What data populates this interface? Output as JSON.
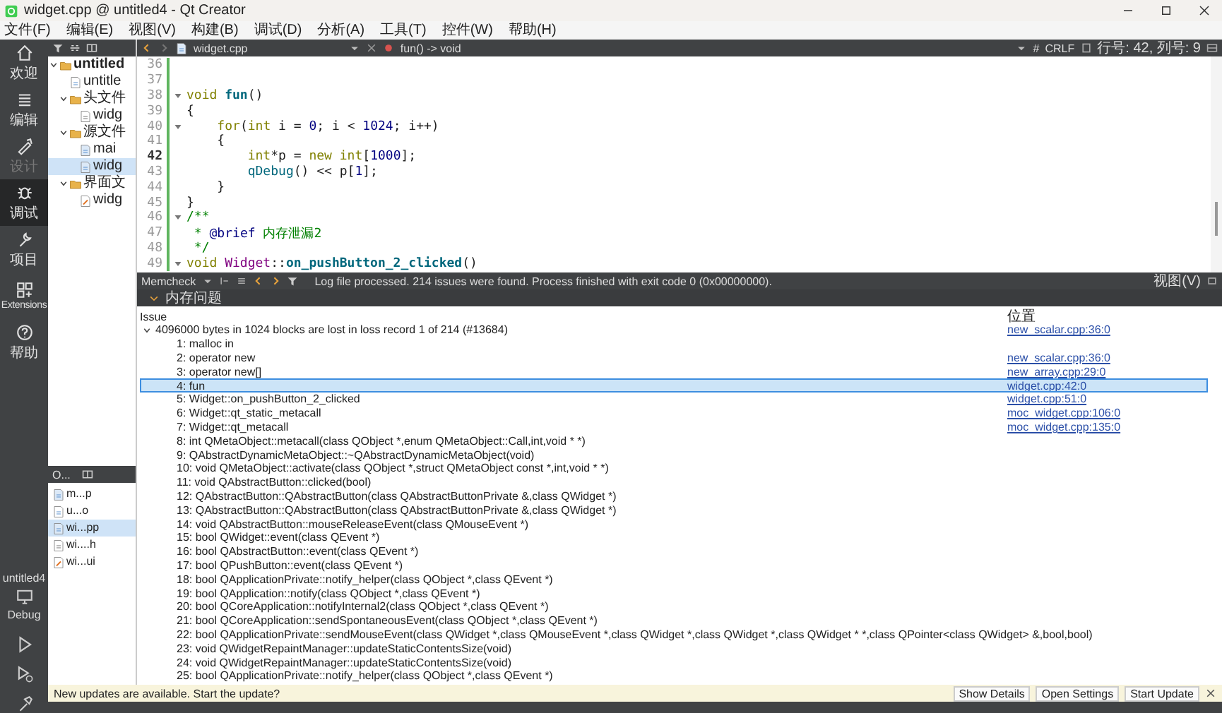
{
  "window": {
    "title": "widget.cpp @ untitled4 - Qt Creator"
  },
  "menu": [
    "文件(F)",
    "编辑(E)",
    "视图(V)",
    "构建(B)",
    "调试(D)",
    "分析(A)",
    "工具(T)",
    "控件(W)",
    "帮助(H)"
  ],
  "mode_bar": {
    "items": [
      {
        "label": "欢迎",
        "selected": false,
        "disabled": false
      },
      {
        "label": "编辑",
        "selected": false,
        "disabled": false
      },
      {
        "label": "设计",
        "selected": false,
        "disabled": true
      },
      {
        "label": "调试",
        "selected": true,
        "disabled": false
      },
      {
        "label": "项目",
        "selected": false,
        "disabled": false
      },
      {
        "label": "Extensions",
        "selected": false,
        "disabled": false
      },
      {
        "label": "帮助",
        "selected": false,
        "disabled": false
      }
    ],
    "target": {
      "project": "untitled4",
      "config": "Debug"
    }
  },
  "project_tree": [
    {
      "label": "untitled",
      "kind": "project",
      "selected": false,
      "expanded": true,
      "children": [
        {
          "label": "untitle",
          "kind": "pro",
          "selected": false
        },
        {
          "label": "头文件",
          "kind": "folder",
          "selected": false,
          "expanded": true,
          "children": [
            {
              "label": "widg",
              "kind": "header",
              "selected": false
            }
          ]
        },
        {
          "label": "源文件",
          "kind": "folder",
          "selected": false,
          "expanded": true,
          "children": [
            {
              "label": "mai",
              "kind": "source",
              "selected": false
            },
            {
              "label": "widg",
              "kind": "source",
              "selected": true
            }
          ]
        },
        {
          "label": "界面文",
          "kind": "folder",
          "selected": false,
          "expanded": true,
          "children": [
            {
              "label": "widg",
              "kind": "form",
              "selected": false
            }
          ]
        }
      ]
    }
  ],
  "open_documents": {
    "title": "O...",
    "items": [
      {
        "label": "m...p",
        "kind": "source",
        "selected": false
      },
      {
        "label": "u...o",
        "kind": "pro",
        "selected": false
      },
      {
        "label": "wi...pp",
        "kind": "source",
        "selected": true
      },
      {
        "label": "wi....h",
        "kind": "header",
        "selected": false
      },
      {
        "label": "wi...ui",
        "kind": "form",
        "selected": false
      }
    ]
  },
  "editor": {
    "file_tab": "widget.cpp",
    "symbol": "fun() -> void",
    "encoding_mark": "#",
    "line_ending": "CRLF",
    "position": "行号: 42, 列号: 9",
    "lines": [
      {
        "number": "36",
        "current": false,
        "foldable": false
      },
      {
        "number": "37",
        "current": false,
        "foldable": false
      },
      {
        "number": "38",
        "current": false,
        "foldable": true,
        "tokens": [
          {
            "text": "void ",
            "kind": "keyword"
          },
          {
            "text": "fun",
            "kind": "function"
          },
          {
            "text": "()",
            "kind": "plain"
          }
        ]
      },
      {
        "number": "39",
        "current": false,
        "foldable": false,
        "tokens": [
          {
            "text": "{",
            "kind": "plain"
          }
        ]
      },
      {
        "number": "40",
        "current": false,
        "foldable": true,
        "tokens": [
          {
            "text": "    for",
            "kind": "keyword"
          },
          {
            "text": "(",
            "kind": "plain"
          },
          {
            "text": "int",
            "kind": "keyword"
          },
          {
            "text": " i = ",
            "kind": "plain"
          },
          {
            "text": "0",
            "kind": "number"
          },
          {
            "text": "; i < ",
            "kind": "plain"
          },
          {
            "text": "1024",
            "kind": "number"
          },
          {
            "text": "; i++)",
            "kind": "plain"
          }
        ]
      },
      {
        "number": "41",
        "current": false,
        "foldable": false,
        "tokens": [
          {
            "text": "    {",
            "kind": "plain"
          }
        ]
      },
      {
        "number": "42",
        "current": true,
        "foldable": false,
        "tokens": [
          {
            "text": "        int",
            "kind": "keyword"
          },
          {
            "text": "*p = ",
            "kind": "plain"
          },
          {
            "text": "new int",
            "kind": "keyword"
          },
          {
            "text": "[",
            "kind": "plain"
          },
          {
            "text": "1000",
            "kind": "number"
          },
          {
            "text": "];",
            "kind": "plain"
          }
        ]
      },
      {
        "number": "43",
        "current": false,
        "foldable": false,
        "tokens": [
          {
            "text": "        qDebug",
            "kind": "call"
          },
          {
            "text": "() << p[",
            "kind": "plain"
          },
          {
            "text": "1",
            "kind": "number"
          },
          {
            "text": "];",
            "kind": "plain"
          }
        ]
      },
      {
        "number": "44",
        "current": false,
        "foldable": false,
        "tokens": [
          {
            "text": "    }",
            "kind": "plain"
          }
        ]
      },
      {
        "number": "45",
        "current": false,
        "foldable": false,
        "tokens": [
          {
            "text": "}",
            "kind": "plain"
          }
        ]
      },
      {
        "number": "46",
        "current": false,
        "foldable": true,
        "tokens": [
          {
            "text": "/**",
            "kind": "comment"
          }
        ]
      },
      {
        "number": "47",
        "current": false,
        "foldable": false,
        "tokens": [
          {
            "text": " * ",
            "kind": "comment"
          },
          {
            "text": "@brief",
            "kind": "doctag"
          },
          {
            "text": " 内存泄漏2",
            "kind": "comment"
          }
        ]
      },
      {
        "number": "48",
        "current": false,
        "foldable": false,
        "tokens": [
          {
            "text": " */",
            "kind": "comment"
          }
        ]
      },
      {
        "number": "49",
        "current": false,
        "foldable": true,
        "tokens": [
          {
            "text": "void ",
            "kind": "keyword"
          },
          {
            "text": "Widget",
            "kind": "type"
          },
          {
            "text": "::",
            "kind": "plain"
          },
          {
            "text": "on_pushButton_2_clicked",
            "kind": "function"
          },
          {
            "text": "()",
            "kind": "plain"
          }
        ]
      }
    ]
  },
  "memcheck": {
    "tool": "Memcheck",
    "message": "Log file processed. 214 issues were found. Process finished with exit code 0 (0x00000000).",
    "view_menu": "视图(V)",
    "category": "内存问题",
    "columns": [
      "Issue",
      "位置"
    ],
    "issues": [
      {
        "text": "4096000 bytes in 1024 blocks are lost in loss record 1 of 214 (#13684)",
        "location": "new_scalar.cpp:36:0",
        "selected": false,
        "expanded": true,
        "children": [
          {
            "text": "1: malloc in",
            "selected": false
          },
          {
            "text": "2: operator new",
            "location": "new_scalar.cpp:36:0",
            "selected": false
          },
          {
            "text": "3: operator new[]",
            "location": "new_array.cpp:29:0",
            "selected": false
          },
          {
            "text": "4: fun",
            "location": "widget.cpp:42:0",
            "selected": true
          },
          {
            "text": "5: Widget::on_pushButton_2_clicked",
            "location": "widget.cpp:51:0",
            "selected": false
          },
          {
            "text": "6: Widget::qt_static_metacall",
            "location": "moc_widget.cpp:106:0",
            "selected": false
          },
          {
            "text": "7: Widget::qt_metacall",
            "location": "moc_widget.cpp:135:0",
            "selected": false
          },
          {
            "text": "8: int QMetaObject::metacall(class QObject *,enum QMetaObject::Call,int,void * *)",
            "selected": false
          },
          {
            "text": "9: QAbstractDynamicMetaObject::~QAbstractDynamicMetaObject(void)",
            "selected": false
          },
          {
            "text": "10: void QMetaObject::activate(class QObject *,struct QMetaObject const *,int,void * *)",
            "selected": false
          },
          {
            "text": "11: void QAbstractButton::clicked(bool)",
            "selected": false
          },
          {
            "text": "12: QAbstractButton::QAbstractButton(class QAbstractButtonPrivate &,class QWidget *)",
            "selected": false
          },
          {
            "text": "13: QAbstractButton::QAbstractButton(class QAbstractButtonPrivate &,class QWidget *)",
            "selected": false
          },
          {
            "text": "14: void QAbstractButton::mouseReleaseEvent(class QMouseEvent *)",
            "selected": false
          },
          {
            "text": "15: bool QWidget::event(class QEvent *)",
            "selected": false
          },
          {
            "text": "16: bool QAbstractButton::event(class QEvent *)",
            "selected": false
          },
          {
            "text": "17: bool QPushButton::event(class QEvent *)",
            "selected": false
          },
          {
            "text": "18: bool QApplicationPrivate::notify_helper(class QObject *,class QEvent *)",
            "selected": false
          },
          {
            "text": "19: bool QApplication::notify(class QObject *,class QEvent *)",
            "selected": false
          },
          {
            "text": "20: bool QCoreApplication::notifyInternal2(class QObject *,class QEvent *)",
            "selected": false
          },
          {
            "text": "21: bool QCoreApplication::sendSpontaneousEvent(class QObject *,class QEvent *)",
            "selected": false
          },
          {
            "text": "22: bool QApplicationPrivate::sendMouseEvent(class QWidget *,class QMouseEvent *,class QWidget *,class QWidget *,class QWidget * *,class QPointer<class QWidget> &,bool,bool)",
            "selected": false
          },
          {
            "text": "23: void QWidgetRepaintManager::updateStaticContentsSize(void)",
            "selected": false
          },
          {
            "text": "24: void QWidgetRepaintManager::updateStaticContentsSize(void)",
            "selected": false
          },
          {
            "text": "25: bool QApplicationPrivate::notify_helper(class QObject *,class QEvent *)",
            "selected": false
          }
        ]
      }
    ]
  },
  "notification": {
    "message": "New updates are available. Start the update?",
    "buttons": [
      "Show Details",
      "Open Settings",
      "Start Update"
    ]
  }
}
